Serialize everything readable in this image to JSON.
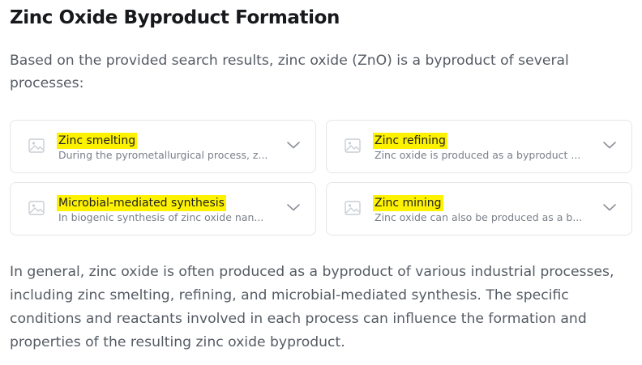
{
  "heading": "Zinc Oxide Byproduct Formation",
  "intro": "Based on the provided search results, zinc oxide (ZnO) is a byproduct of several processes:",
  "cards": [
    {
      "title": "Zinc smelting",
      "description": "During the pyrometallurgical process, z...",
      "icon": "image-placeholder-icon",
      "expand_icon": "chevron-down-icon",
      "highlighted": true
    },
    {
      "title": "Zinc refining",
      "description": "Zinc oxide is produced as a byproduct ...",
      "icon": "image-placeholder-icon",
      "expand_icon": "chevron-down-icon",
      "highlighted": true
    },
    {
      "title": "Microbial-mediated synthesis",
      "description": "In biogenic synthesis of zinc oxide nan...",
      "icon": "image-placeholder-icon",
      "expand_icon": "chevron-down-icon",
      "highlighted": true
    },
    {
      "title": "Zinc mining",
      "description": "Zinc oxide can also be produced as a b...",
      "icon": "image-placeholder-icon",
      "expand_icon": "chevron-down-icon",
      "highlighted": true
    }
  ],
  "summary": "In general, zinc oxide is often produced as a byproduct of various industrial processes, including zinc smelting, refining, and microbial-mediated synthesis. The specific conditions and reactants involved in each process can influence the formation and properties of the resulting zinc oxide byproduct.",
  "colors": {
    "highlight": "#fff200",
    "card_border": "#e4e6ea",
    "body_text": "#555b64",
    "heading_text": "#17191c"
  }
}
